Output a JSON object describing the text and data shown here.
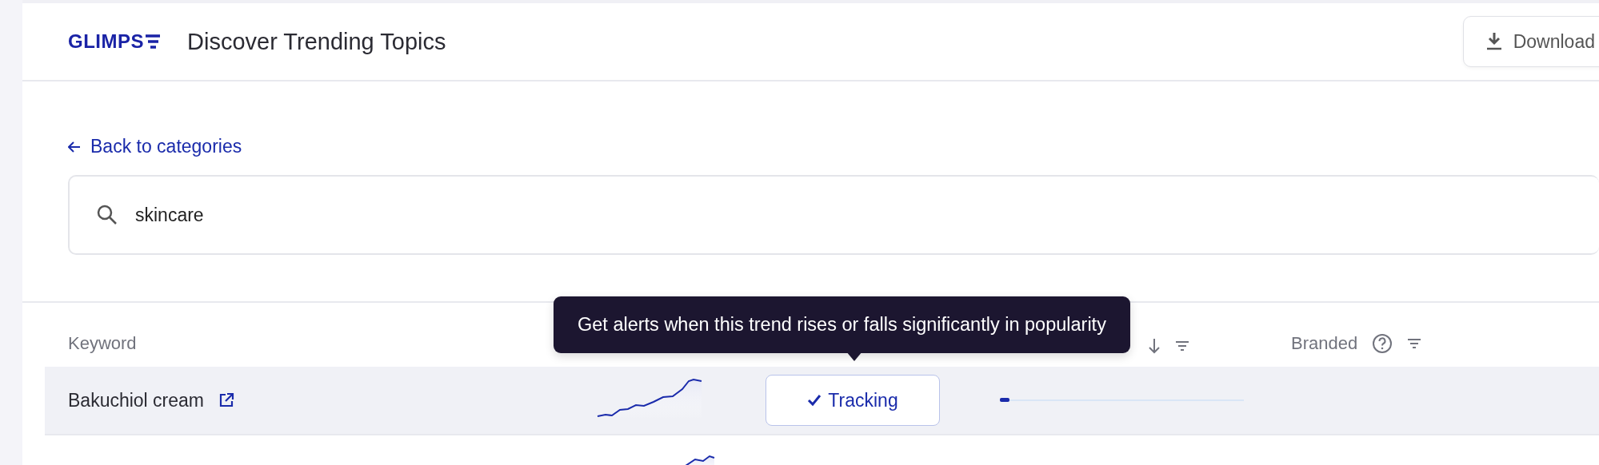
{
  "header": {
    "logo": "GLIMPS",
    "title": "Discover Trending Topics",
    "download_button": "Download"
  },
  "back_link": "Back to categories",
  "search": {
    "value": "skincare"
  },
  "table": {
    "columns": [
      {
        "label": "Keyword",
        "kind": "text"
      },
      {
        "kind": "sort"
      },
      {
        "label": "Branded",
        "kind": "help"
      }
    ],
    "rows": [
      {
        "keyword": "Bakuchiol cream",
        "tracking": "Tracking",
        "tracked": true,
        "level": 0.04,
        "hovered": true
      },
      {
        "hovered": false
      }
    ]
  },
  "tooltip": "Get alerts when this trend rises or falls significantly in popularity"
}
